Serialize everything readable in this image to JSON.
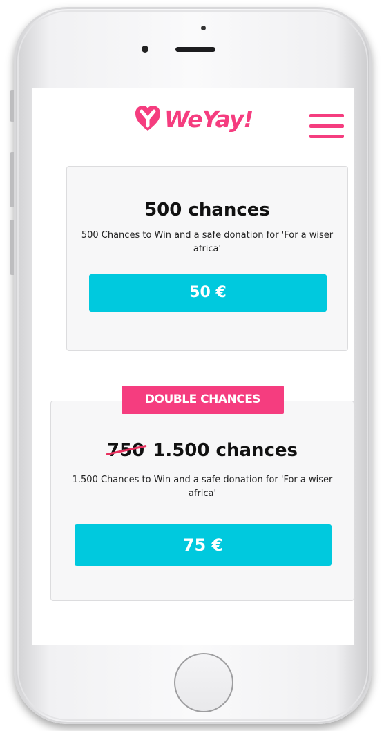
{
  "brand": {
    "name": "WeYay!",
    "color": "#f53d7f",
    "logo_icon": "heart-y-logo-icon"
  },
  "header": {
    "menu_icon": "hamburger-menu-icon"
  },
  "colors": {
    "accent": "#f53d7f",
    "button": "#00c9de",
    "strike": "#e8315f"
  },
  "offers": [
    {
      "title": "500 chances",
      "description": "500 Chances to Win and a safe donation for 'For a wiser africa'",
      "price": "50 €"
    },
    {
      "badge": "DOUBLE CHANCES",
      "old_chances": "750",
      "title": "1.500 chances",
      "description": "1.500 Chances to Win and a safe donation for 'For a wiser africa'",
      "price": "75 €"
    }
  ]
}
